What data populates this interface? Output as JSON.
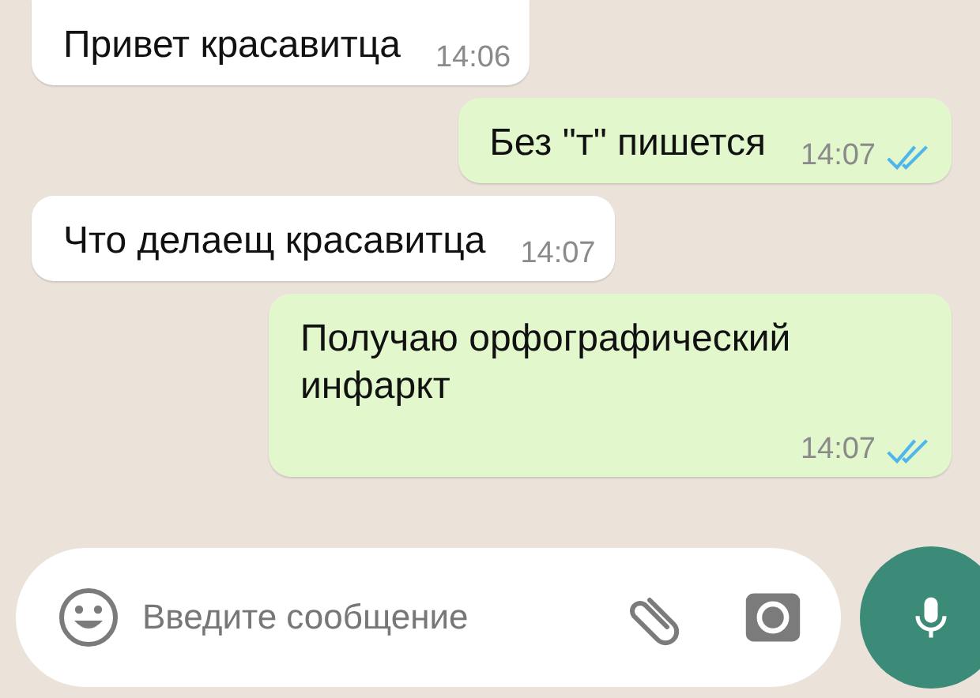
{
  "messages": [
    {
      "kind": "incoming",
      "text": "Привет красавитца",
      "time": "14:06"
    },
    {
      "kind": "outgoing",
      "text": "Без \"т\" пишется",
      "time": "14:07",
      "read": true
    },
    {
      "kind": "incoming",
      "text": "Что делаещ красавитца",
      "time": "14:07"
    },
    {
      "kind": "outgoing",
      "text": "Получаю орфографический инфаркт",
      "time": "14:07",
      "read": true
    }
  ],
  "composer": {
    "placeholder": "Введите сообщение"
  }
}
